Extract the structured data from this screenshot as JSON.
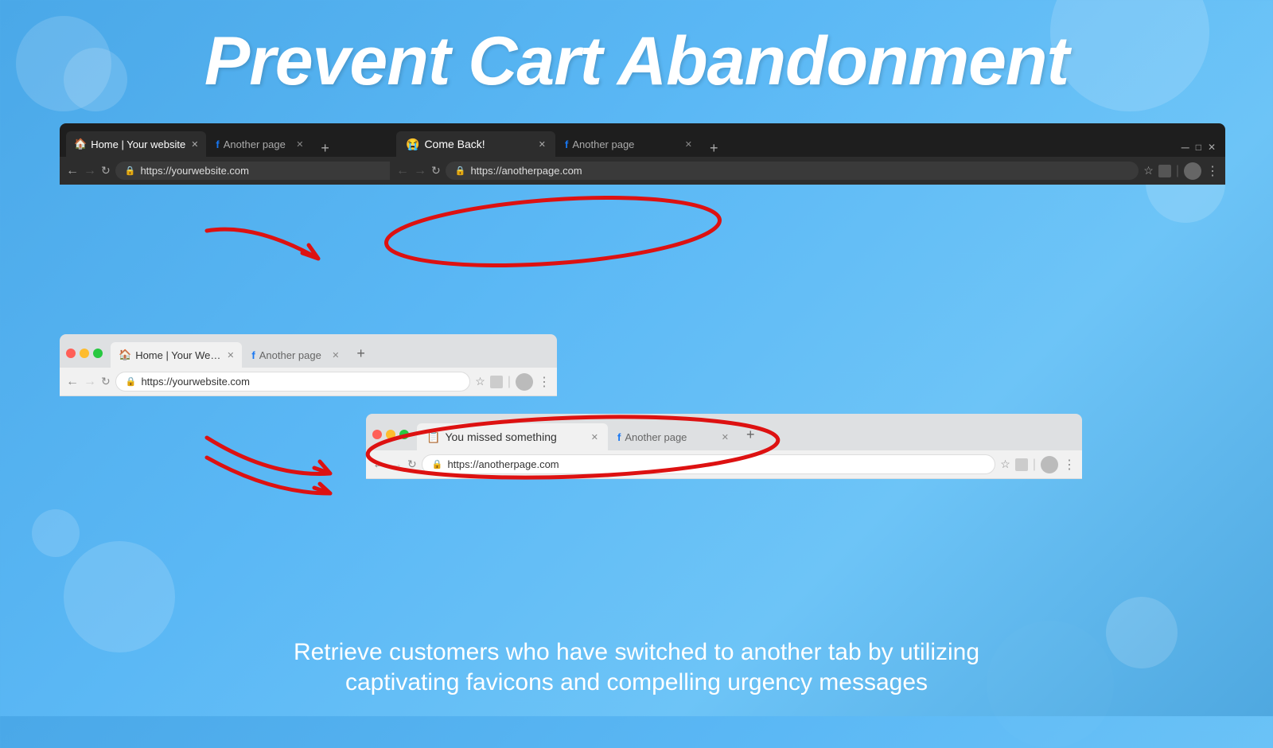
{
  "page": {
    "title": "Prevent Cart Abandonment",
    "bg_color": "#5aadec"
  },
  "header": {
    "main_title": "Prevent Cart Abandonment",
    "subtitle_line1": "Retrieve customers who have switched to another tab by utilizing",
    "subtitle_line2": "captivating favicons and compelling urgency messages"
  },
  "browser_top_dark": {
    "tab1_favicon": "🏠",
    "tab1_label": "Home | Your website",
    "tab2_favicon": "f",
    "tab2_label": "Another page",
    "url": "https://yourwebsite.com",
    "come_back_tab_emoji": "😭",
    "come_back_tab_label": "Come Back!",
    "another_page_label": "Another page",
    "another_url": "https://anotherpage.com"
  },
  "browser_bottom_light": {
    "tab1_favicon": "🏠",
    "tab1_label": "Home | Your Website",
    "tab2_favicon": "f",
    "tab2_label": "Another page",
    "url": "https://yourwebsite.com",
    "you_missed_emoji": "📋",
    "you_missed_label": "You missed something",
    "another_url": "https://anotherpage.com"
  },
  "arrows": {
    "arrow1_label": "arrow pointing to come back tab",
    "arrow2_label": "arrow pointing to you missed something tab"
  }
}
